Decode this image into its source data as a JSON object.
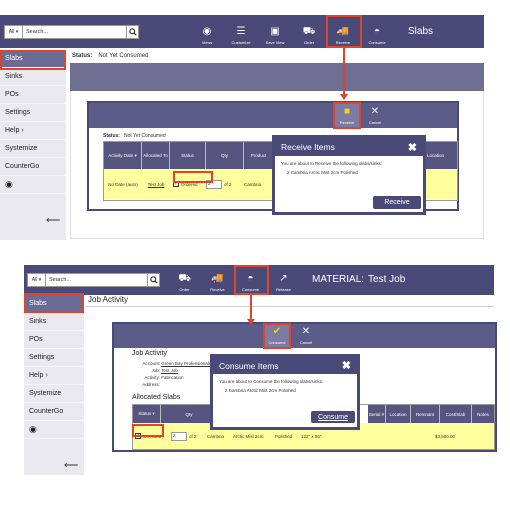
{
  "panel1": {
    "search": {
      "all": "All ▾",
      "placeholder": "Search..."
    },
    "toolbar": [
      "Views",
      "Customize",
      "Save View",
      "Order",
      "Receive",
      "Consume"
    ],
    "title": "Slabs",
    "status_label": "Status:",
    "status_value": "Not Yet Consumed",
    "sidebar": [
      "Slabs",
      "Sinks",
      "POs",
      "Settings",
      "Help ›",
      "Systemize",
      "CounterGo"
    ],
    "inner_toolbar": [
      "Receive",
      "Cancel"
    ],
    "inner_status_label": "Status:",
    "inner_status_value": "Not Yet Consumed",
    "table_headers": [
      "Activity Date ▾",
      "Allocated To",
      "Status",
      "Qty",
      "Product",
      "Location"
    ],
    "row": {
      "date": "No Date (auto)",
      "alloc": "Test Job",
      "status": "Ordered",
      "qty": "2",
      "of": "of 2",
      "product": "Cambria"
    },
    "modal": {
      "title": "Receive Items",
      "text": "You are about to Receive the following slabs/sinks:",
      "item": "2 Cambria Arctic Mist 2cm Polished",
      "button": "Receive"
    }
  },
  "panel2": {
    "search": {
      "all": "All ▾",
      "placeholder": "Search..."
    },
    "toolbar": [
      "Order",
      "Receive",
      "Consume",
      "Release"
    ],
    "title_prefix": "MATERIAL:",
    "title": "Test Job",
    "page_heading": "Job Activity",
    "sidebar": [
      "Slabs",
      "Sinks",
      "POs",
      "Settings",
      "Help ›",
      "Systemize",
      "CounterGo"
    ],
    "inner_toolbar": [
      "Consume",
      "Cancel"
    ],
    "inner_heading": "Job Activity",
    "account_label": "Account:",
    "account_value": "Green Bay Professionals",
    "job_label": "Job:",
    "job_value": "Test Job",
    "activity_label": "Activity:",
    "activity_value": "Fabrication",
    "address_label": "Address:",
    "allocated_heading": "Allocated Slabs",
    "table_headers": [
      "Status ▾",
      "Qty",
      "Serial #",
      "Location",
      "Remnant",
      "Cost/Slab",
      "Notes"
    ],
    "row": {
      "status": "On Hand",
      "qty": "2",
      "of": "of 2",
      "brand": "Cambria",
      "color": "Arctic Mist",
      "thick": "2cm",
      "finish": "Polished",
      "size": "122\" x 56\"",
      "cost": "$3,500.00"
    },
    "modal": {
      "title": "Consume Items",
      "text": "You are about to Consume the following slabs/sinks:",
      "item": "2 Cambria Arctic Mist 2cm Polished",
      "button": "Consume"
    }
  }
}
